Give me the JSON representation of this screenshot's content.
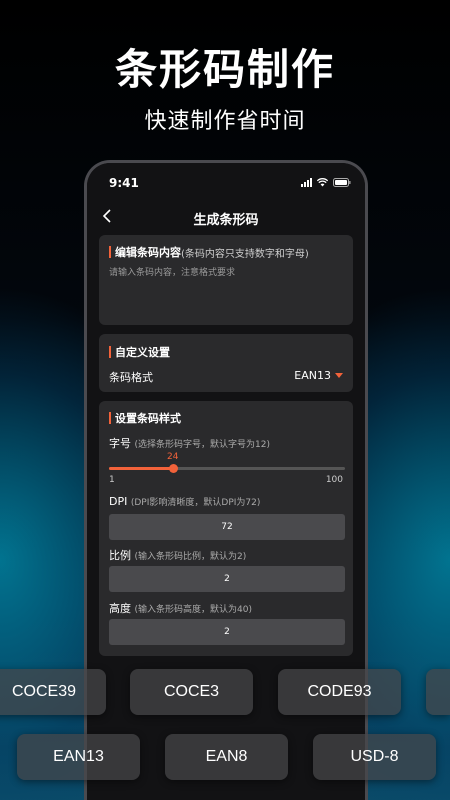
{
  "hero": {
    "title": "条形码制作",
    "subtitle": "快速制作省时间"
  },
  "status_bar": {
    "time": "9:41"
  },
  "nav": {
    "title": "生成条形码"
  },
  "content_card": {
    "title": "编辑条码内容",
    "hint": "(条码内容只支持数字和字母)",
    "placeholder": "请输入条码内容，注意格式要求"
  },
  "custom_card": {
    "title": "自定义设置",
    "format_label": "条码格式",
    "format_value": "EAN13"
  },
  "style_card": {
    "title": "设置条码样式",
    "font_size": {
      "label": "字号",
      "hint": "(选择条形码字号，默认字号为12)",
      "value": "24",
      "min": "1",
      "max": "100",
      "fraction": 0.27
    },
    "dpi": {
      "label": "DPI",
      "hint": "(DPI影响清晰度，默认DPI为72)",
      "value": "72"
    },
    "ratio": {
      "label": "比例",
      "hint": "(输入条形码比例，默认为2)",
      "value": "2"
    },
    "height": {
      "label": "高度",
      "hint": "(输入条形码高度，默认为40)",
      "value": "2"
    }
  },
  "format_chips_row1": [
    "COCE39",
    "COCE3",
    "CODE93"
  ],
  "format_chips_row2": [
    "EAN13",
    "EAN8",
    "USD-8"
  ],
  "colors": {
    "accent": "#f2623a",
    "card": "#2a2a2c",
    "input": "#4a4a4d"
  }
}
